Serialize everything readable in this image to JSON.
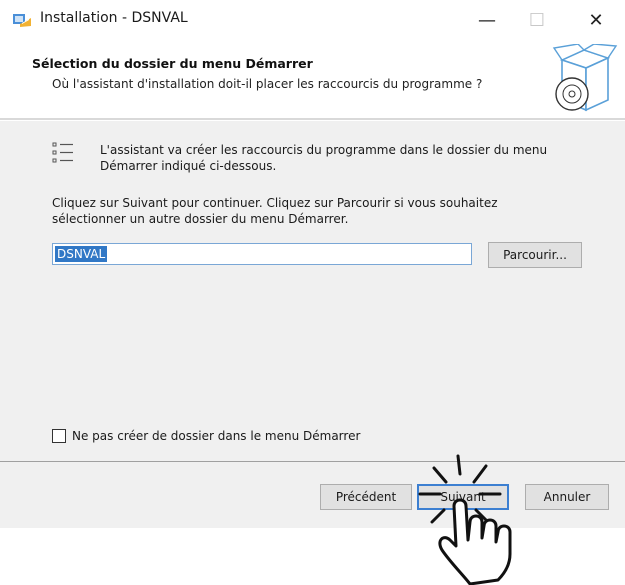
{
  "window": {
    "title": "Installation - DSNVAL",
    "minimize_glyph": "—",
    "maximize_glyph": "☐",
    "close_glyph": "✕"
  },
  "header": {
    "title": "Sélection du dossier du menu Démarrer",
    "subtitle": "Où l'assistant d'installation doit-il placer les raccourcis du programme ?"
  },
  "content": {
    "info_line1": "L'assistant va créer les raccourcis du programme dans le dossier du menu",
    "info_line2": "Démarrer indiqué ci-dessous.",
    "instr_line1": "Cliquez sur Suivant pour continuer. Cliquez sur Parcourir si vous souhaitez",
    "instr_line2": "sélectionner un autre dossier du menu Démarrer.",
    "folder_value": "DSNVAL",
    "browse_label": "Parcourir...",
    "checkbox_label": "Ne pas créer de dossier dans le menu Démarrer",
    "checkbox_checked": false
  },
  "footer": {
    "prev_label": "Précédent",
    "next_label": "Suivant",
    "cancel_label": "Annuler"
  },
  "icons": {
    "app": "installer-app-icon",
    "header": "box-cd-icon",
    "list": "list-icon",
    "overlay": "pointing-hand-icon"
  },
  "colors": {
    "accent": "#3c7fd1",
    "selection": "#3178c6",
    "panel": "#f0f0f0"
  }
}
